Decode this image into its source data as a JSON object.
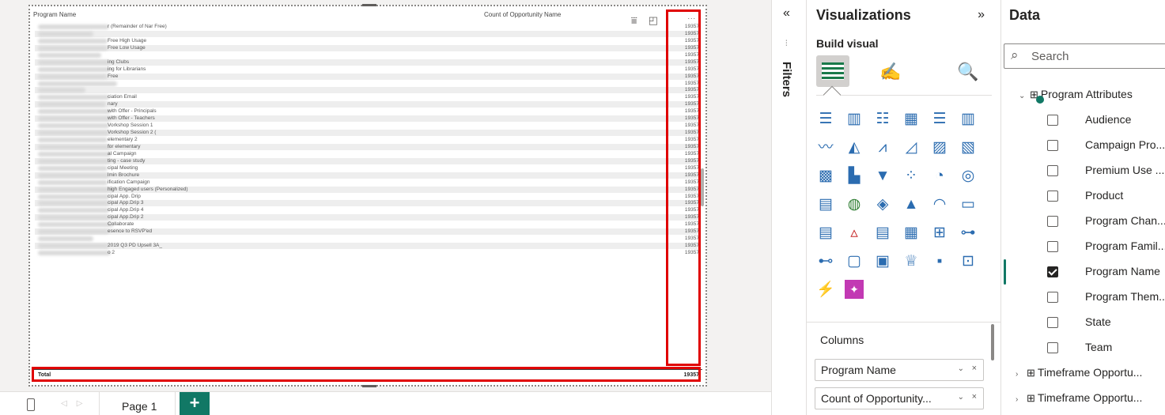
{
  "table_visual": {
    "col_program": "Program Name",
    "col_count": "Count of Opportunity Name",
    "more": "...",
    "rows": [
      {
        "name": "r (Remainder of Nar Free)",
        "value": "19357",
        "blur": 90
      },
      {
        "name": "",
        "value": "19357",
        "blur": 70
      },
      {
        "name": "Free High Usage",
        "value": "19357",
        "blur": 88
      },
      {
        "name": "Free Low Usage",
        "value": "19357",
        "blur": 88
      },
      {
        "name": "",
        "value": "19357",
        "blur": 80
      },
      {
        "name": "ing Clubs",
        "value": "19357",
        "blur": 92
      },
      {
        "name": "ing for Librarians",
        "value": "19357",
        "blur": 92
      },
      {
        "name": "Free",
        "value": "19357",
        "blur": 88
      },
      {
        "name": "",
        "value": "19357",
        "blur": 100
      },
      {
        "name": "",
        "value": "19357",
        "blur": 60
      },
      {
        "name": "ciation Email",
        "value": "19357",
        "blur": 90
      },
      {
        "name": "nary",
        "value": "19357",
        "blur": 86
      },
      {
        "name": "with Offer - Principals",
        "value": "19357",
        "blur": 92
      },
      {
        "name": "with Offer - Teachers",
        "value": "19357",
        "blur": 92
      },
      {
        "name": "Vorkshop Session 1",
        "value": "19357",
        "blur": 90
      },
      {
        "name": "Vorkshop Session 2 (",
        "value": "19357",
        "blur": 90
      },
      {
        "name": "elementary 2",
        "value": "19357",
        "blur": 88
      },
      {
        "name": "for elementary",
        "value": "19357",
        "blur": 92
      },
      {
        "name": "al Campaign",
        "value": "19357",
        "blur": 92
      },
      {
        "name": "ting - case study",
        "value": "19357",
        "blur": 92
      },
      {
        "name": "cipal Meeting",
        "value": "19357",
        "blur": 88
      },
      {
        "name": "lmin Brochure",
        "value": "19357",
        "blur": 90
      },
      {
        "name": "ification Campaign",
        "value": "19357",
        "blur": 88
      },
      {
        "name": "high Engaged users (Personalized)",
        "value": "19357",
        "blur": 96
      },
      {
        "name": "cipal App. Drip",
        "value": "19357",
        "blur": 90
      },
      {
        "name": "cipal App.Drip 3",
        "value": "19357",
        "blur": 90
      },
      {
        "name": "cipal App.Drip 4",
        "value": "19357",
        "blur": 90
      },
      {
        "name": "cipal App.Drip 2",
        "value": "19357",
        "blur": 90
      },
      {
        "name": "Collaborate",
        "value": "19357",
        "blur": 96
      },
      {
        "name": "esence to RSVP'ed",
        "value": "19357",
        "blur": 90
      },
      {
        "name": "",
        "value": "19357",
        "blur": 70
      },
      {
        "name": "2019 Q3 PD Upsell 3A_",
        "value": "19357",
        "blur": 90
      },
      {
        "name": "o 2",
        "value": "19357",
        "blur": 92
      }
    ],
    "total_label": "Total",
    "total_value": "19357"
  },
  "pages": {
    "current": "Page 1",
    "add": "+"
  },
  "filters": {
    "label": "Filters",
    "collapse": "«"
  },
  "visualizations": {
    "title": "Visualizations",
    "expand": "»",
    "build_visual": "Build visual",
    "icons": [
      {
        "name": "stacked-bar-chart-icon",
        "g": "☰",
        "c": "c-blue"
      },
      {
        "name": "stacked-column-chart-icon",
        "g": "▥",
        "c": "c-blue"
      },
      {
        "name": "clustered-bar-chart-icon",
        "g": "☷",
        "c": "c-blue"
      },
      {
        "name": "clustered-column-chart-icon",
        "g": "▦",
        "c": "c-blue"
      },
      {
        "name": "100-stacked-bar-chart-icon",
        "g": "☰",
        "c": "c-blue"
      },
      {
        "name": "100-stacked-column-chart-icon",
        "g": "▥",
        "c": "c-blue"
      },
      {
        "name": "line-chart-icon",
        "g": "〰",
        "c": "c-blue"
      },
      {
        "name": "area-chart-icon",
        "g": "◭",
        "c": "c-blue"
      },
      {
        "name": "stacked-area-chart-icon",
        "g": "⩘",
        "c": "c-blue"
      },
      {
        "name": "100-stacked-area-chart-icon",
        "g": "◿",
        "c": "c-blue"
      },
      {
        "name": "line-and-stacked-column-chart-icon",
        "g": "▨",
        "c": "c-blue"
      },
      {
        "name": "line-and-clustered-column-chart-icon",
        "g": "▧",
        "c": "c-blue"
      },
      {
        "name": "ribbon-chart-icon",
        "g": "▩",
        "c": "c-blue"
      },
      {
        "name": "waterfall-chart-icon",
        "g": "▙",
        "c": "c-blue"
      },
      {
        "name": "funnel-chart-icon",
        "g": "▼",
        "c": "c-blue"
      },
      {
        "name": "scatter-chart-icon",
        "g": "⁘",
        "c": "c-blue"
      },
      {
        "name": "pie-chart-icon",
        "g": "◔",
        "c": "c-blue"
      },
      {
        "name": "donut-chart-icon",
        "g": "◎",
        "c": "c-blue"
      },
      {
        "name": "treemap-icon",
        "g": "▤",
        "c": "c-blue"
      },
      {
        "name": "map-icon",
        "g": "◍",
        "c": "c-green"
      },
      {
        "name": "filled-map-icon",
        "g": "◈",
        "c": "c-blue"
      },
      {
        "name": "azure-map-icon",
        "g": "▲",
        "c": "c-blue"
      },
      {
        "name": "gauge-icon",
        "g": "◠",
        "c": "c-blue"
      },
      {
        "name": "card-icon",
        "g": "▭",
        "c": "c-blue"
      },
      {
        "name": "multi-row-card-icon",
        "g": "▤",
        "c": "c-blue"
      },
      {
        "name": "kpi-icon",
        "g": "▵",
        "c": "c-red"
      },
      {
        "name": "slicer-icon",
        "g": "▤",
        "c": "c-blue"
      },
      {
        "name": "table-icon",
        "g": "▦",
        "c": "c-blue"
      },
      {
        "name": "matrix-icon",
        "g": "⊞",
        "c": "c-blue"
      },
      {
        "name": "decomposition-tree-icon",
        "g": "⊶",
        "c": "c-blue"
      },
      {
        "name": "key-influencers-icon",
        "g": "⊷",
        "c": "c-blue"
      },
      {
        "name": "qna-icon",
        "g": "▢",
        "c": "c-blue"
      },
      {
        "name": "smart-narrative-icon",
        "g": "▣",
        "c": "c-blue"
      },
      {
        "name": "metrics-icon",
        "g": "♕",
        "c": "c-blue"
      },
      {
        "name": "paginated-report-icon",
        "g": "▪",
        "c": "c-blue"
      },
      {
        "name": "power-apps-icon",
        "g": "⊡",
        "c": "c-blue"
      },
      {
        "name": "power-automate-icon",
        "g": "⚡",
        "c": "c-blue"
      },
      {
        "name": "custom-visual-icon",
        "g": "✦",
        "c": ""
      }
    ],
    "columns_label": "Columns",
    "wells": [
      "Program Name",
      "Count of Opportunity..."
    ]
  },
  "data_pane": {
    "title": "Data",
    "search_placeholder": "Search",
    "table_program": "Program Attributes",
    "fields": [
      {
        "label": "Audience",
        "checked": false
      },
      {
        "label": "Campaign Pro...",
        "checked": false
      },
      {
        "label": "Premium Use ...",
        "checked": false
      },
      {
        "label": "Product",
        "checked": false
      },
      {
        "label": "Program Chan...",
        "checked": false
      },
      {
        "label": "Program Famil...",
        "checked": false
      },
      {
        "label": "Program Name",
        "checked": true
      },
      {
        "label": "Program Them...",
        "checked": false
      },
      {
        "label": "State",
        "checked": false
      },
      {
        "label": "Team",
        "checked": false
      }
    ],
    "table_timeframe_1": "Timeframe Opportu...",
    "table_timeframe_2": "Timeframe Opportu..."
  },
  "colors": {
    "accent": "#117865",
    "highlight": "#e00000"
  }
}
